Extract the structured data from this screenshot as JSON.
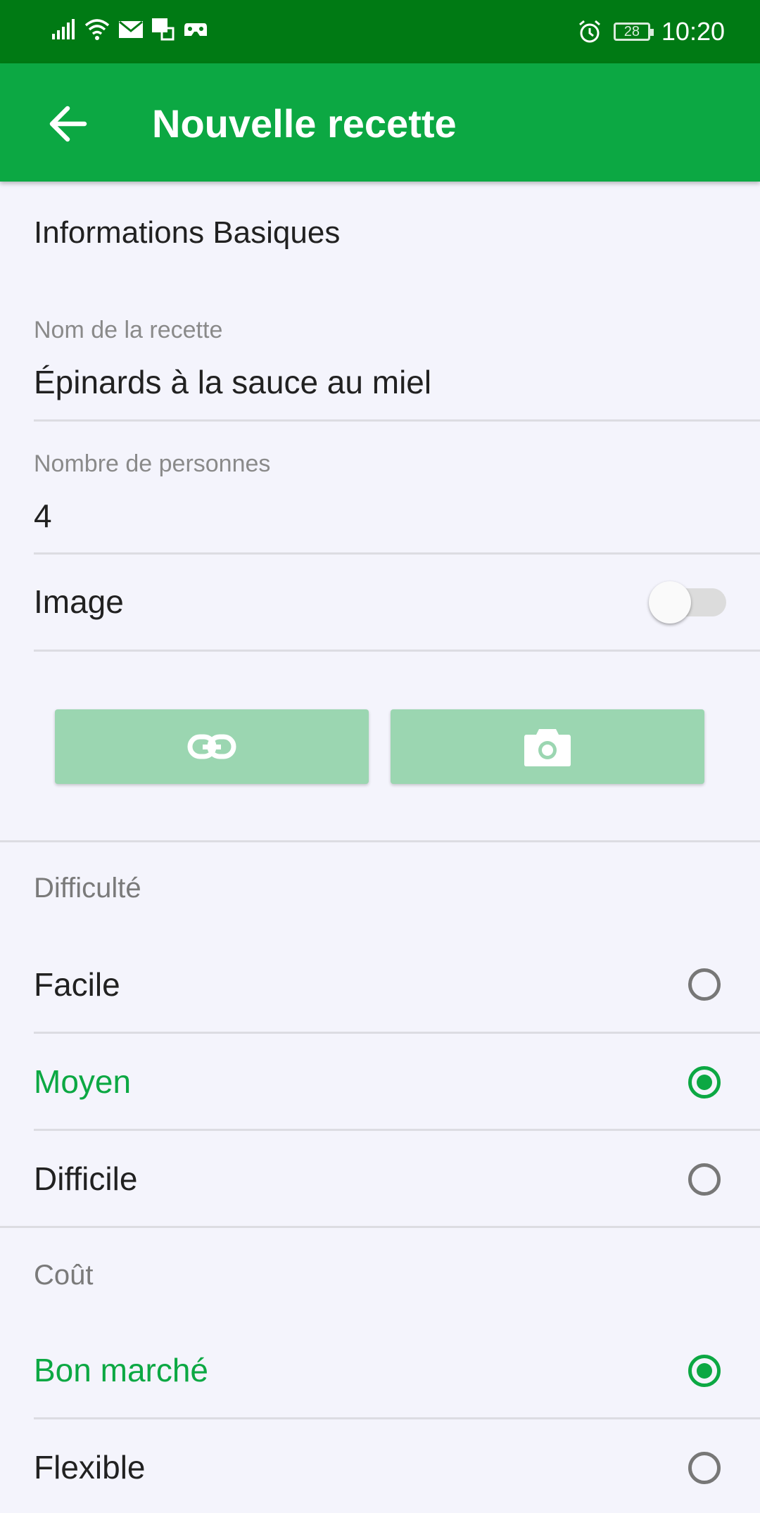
{
  "status_bar": {
    "time": "10:20",
    "battery": "28",
    "icons": [
      "signal-icon",
      "wifi-icon",
      "mail-icon",
      "sms-icon",
      "game-icon",
      "alarm-icon",
      "battery-icon"
    ]
  },
  "app_bar": {
    "title": "Nouvelle recette",
    "back_icon": "arrow-back-icon"
  },
  "basic_info": {
    "title": "Informations Basiques",
    "name_label": "Nom de la recette",
    "name_value": "Épinards à la sauce au miel",
    "people_label": "Nombre de personnes",
    "people_value": "4",
    "image_label": "Image",
    "image_toggle_on": false,
    "link_button_icon": "link-icon",
    "camera_button_icon": "camera-icon"
  },
  "difficulty": {
    "title": "Difficulté",
    "options": [
      {
        "label": "Facile",
        "selected": false
      },
      {
        "label": "Moyen",
        "selected": true
      },
      {
        "label": "Difficile",
        "selected": false
      }
    ]
  },
  "cost": {
    "title": "Coût",
    "options": [
      {
        "label": "Bon marché",
        "selected": true
      },
      {
        "label": "Flexible",
        "selected": false
      }
    ]
  },
  "colors": {
    "status_bar": "#007a14",
    "app_bar": "#0ca843",
    "accent": "#0ca843",
    "disabled_button": "#9bd6b1",
    "background": "#f4f4fc"
  }
}
